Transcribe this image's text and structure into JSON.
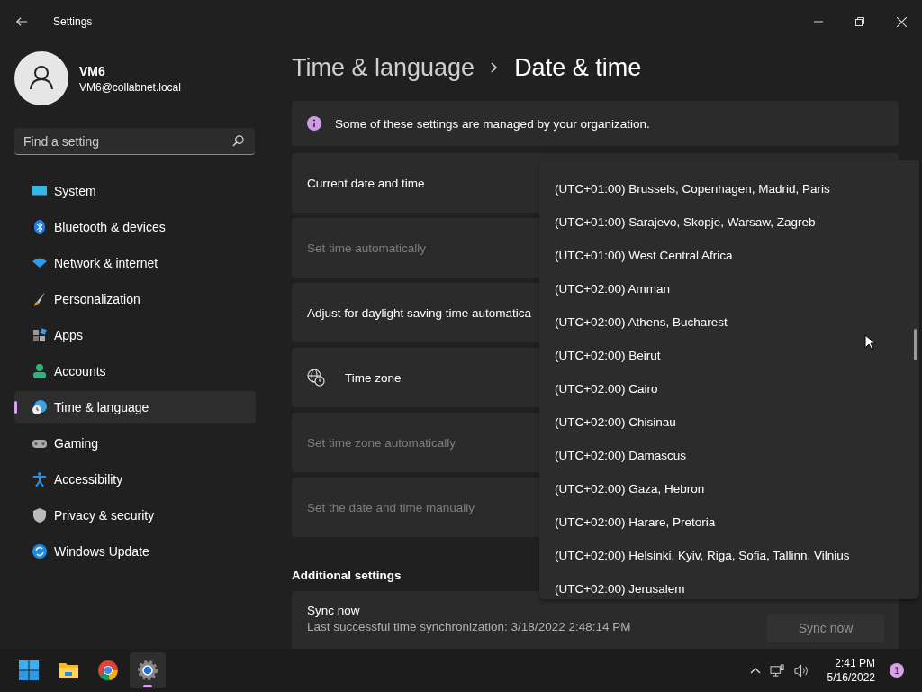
{
  "window": {
    "title": "Settings"
  },
  "user": {
    "name": "VM6",
    "email": "VM6@collabnet.local"
  },
  "search": {
    "placeholder": "Find a setting"
  },
  "nav": [
    {
      "label": "System",
      "selected": false
    },
    {
      "label": "Bluetooth & devices",
      "selected": false
    },
    {
      "label": "Network & internet",
      "selected": false
    },
    {
      "label": "Personalization",
      "selected": false
    },
    {
      "label": "Apps",
      "selected": false
    },
    {
      "label": "Accounts",
      "selected": false
    },
    {
      "label": "Time & language",
      "selected": true
    },
    {
      "label": "Gaming",
      "selected": false
    },
    {
      "label": "Accessibility",
      "selected": false
    },
    {
      "label": "Privacy & security",
      "selected": false
    },
    {
      "label": "Windows Update",
      "selected": false
    }
  ],
  "breadcrumb": [
    "Time & language",
    "Date & time"
  ],
  "notice": "Some of these settings are managed by your organization.",
  "settings": [
    {
      "label": "Current date and time",
      "kind": "plain",
      "disabled": false
    },
    {
      "label": "Set time automatically",
      "kind": "plain",
      "disabled": true
    },
    {
      "label": "Adjust for daylight saving time automatica",
      "kind": "plain",
      "disabled": false
    },
    {
      "label": "Time zone",
      "kind": "icon",
      "disabled": false
    },
    {
      "label": "Set time zone automatically",
      "kind": "plain",
      "disabled": true
    },
    {
      "label": "Set the date and time manually",
      "kind": "plain",
      "disabled": true
    }
  ],
  "additional": {
    "heading": "Additional settings",
    "sync": {
      "title": "Sync now",
      "detail": "Last successful time synchronization: 3/18/2022 2:48:14 PM",
      "button": {
        "label": "Sync now",
        "disabled": true
      }
    }
  },
  "timezone_list": [
    "(UTC+01:00) Brussels, Copenhagen, Madrid, Paris",
    "(UTC+01:00) Sarajevo, Skopje, Warsaw, Zagreb",
    "(UTC+01:00) West Central Africa",
    "(UTC+02:00) Amman",
    "(UTC+02:00) Athens, Bucharest",
    "(UTC+02:00) Beirut",
    "(UTC+02:00) Cairo",
    "(UTC+02:00) Chisinau",
    "(UTC+02:00) Damascus",
    "(UTC+02:00) Gaza, Hebron",
    "(UTC+02:00) Harare, Pretoria",
    "(UTC+02:00) Helsinki, Kyiv, Riga, Sofia, Tallinn, Vilnius",
    "(UTC+02:00) Jerusalem"
  ],
  "taskbar": {
    "apps": [
      {
        "selected": false
      },
      {
        "selected": false
      },
      {
        "selected": false
      },
      {
        "selected": true
      }
    ],
    "time": "2:41 PM",
    "date": "5/16/2022",
    "notifications": "1"
  }
}
